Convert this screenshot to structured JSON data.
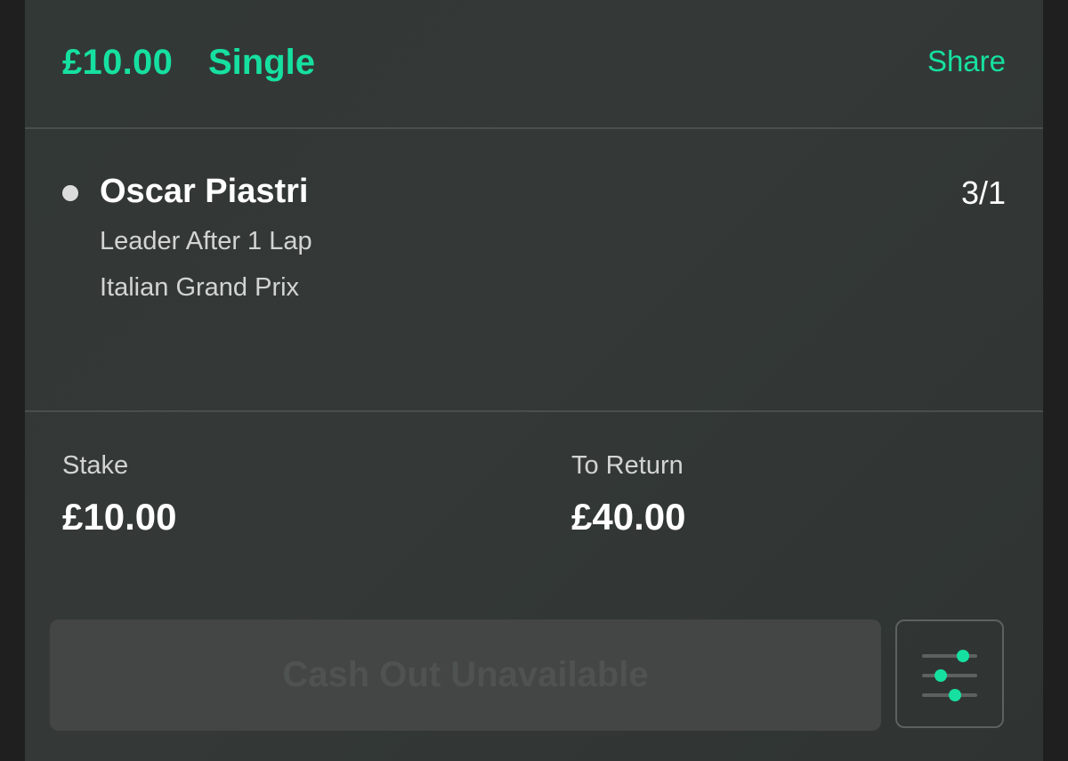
{
  "header": {
    "amount": "£10.00",
    "bet_type": "Single",
    "share_label": "Share"
  },
  "selection": {
    "name": "Oscar Piastri",
    "odds": "3/1",
    "market": "Leader After 1 Lap",
    "event": "Italian Grand Prix"
  },
  "summary": {
    "stake_label": "Stake",
    "stake_value": "£10.00",
    "return_label": "To Return",
    "return_value": "£40.00"
  },
  "actions": {
    "cashout_label": "Cash Out Unavailable",
    "settings_icon": "sliders-icon"
  },
  "colors": {
    "accent": "#16e0a0",
    "card_background": "#343937",
    "disabled_button": "#434645"
  }
}
